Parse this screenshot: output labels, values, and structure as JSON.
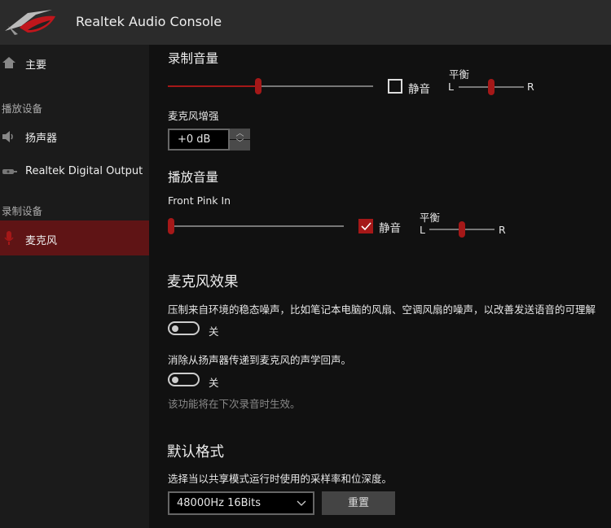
{
  "app": {
    "title": "Realtek Audio Console",
    "accent": "#a51818"
  },
  "sidebar": {
    "home": "主要",
    "playback_header": "播放设备",
    "speakers": "扬声器",
    "digital_output": "Realtek Digital Output",
    "record_header": "录制设备",
    "microphone": "麦克风"
  },
  "record_volume": {
    "title": "录制音量",
    "level_percent": 44,
    "mute_label": "静音",
    "muted": false,
    "balance_label": "平衡",
    "left": "L",
    "right": "R",
    "balance_percent": 50
  },
  "mic_boost": {
    "label": "麦克风增强",
    "value": "+0 dB"
  },
  "playback_volume": {
    "title": "播放音量",
    "device": "Front Pink In",
    "level_percent": 0,
    "mute_label": "静音",
    "muted": true,
    "balance_label": "平衡",
    "left": "L",
    "right": "R",
    "balance_percent": 50
  },
  "effects": {
    "title": "麦克风效果",
    "noise_desc": "压制来自环境的稳态噪声，比如笔记本电脑的风扇、空调风扇的噪声，以改善发送语音的可理解",
    "noise_state": "关",
    "echo_desc": "消除从扬声器传递到麦克风的声学回声。",
    "echo_state": "关",
    "note": "该功能将在下次录音时生效。"
  },
  "format": {
    "title": "默认格式",
    "desc": "选择当以共享模式运行时使用的采样率和位深度。",
    "selected": "48000Hz 16Bits",
    "reset_label": "重置"
  }
}
